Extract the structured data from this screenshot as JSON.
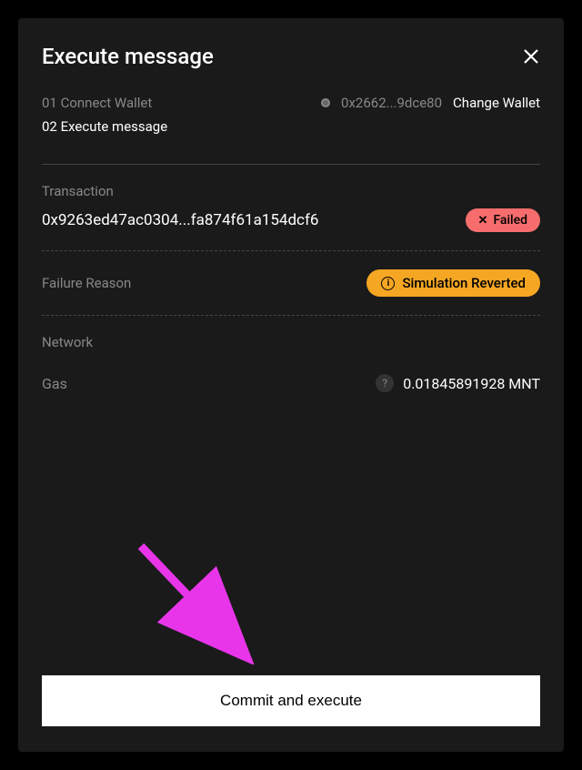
{
  "modal": {
    "title": "Execute message",
    "steps": {
      "step1_label": "01 Connect Wallet",
      "step2_label": "02 Execute message"
    },
    "wallet": {
      "address": "0x2662...9dce80",
      "change_label": "Change Wallet"
    },
    "transaction": {
      "label": "Transaction",
      "hash": "0x9263ed47ac0304...fa874f61a154dcf6",
      "status": "Failed"
    },
    "failure": {
      "label": "Failure Reason",
      "reason": "Simulation Reverted"
    },
    "network": {
      "label": "Network"
    },
    "gas": {
      "label": "Gas",
      "value": "0.01845891928 MNT"
    },
    "actions": {
      "commit_label": "Commit and execute"
    }
  }
}
